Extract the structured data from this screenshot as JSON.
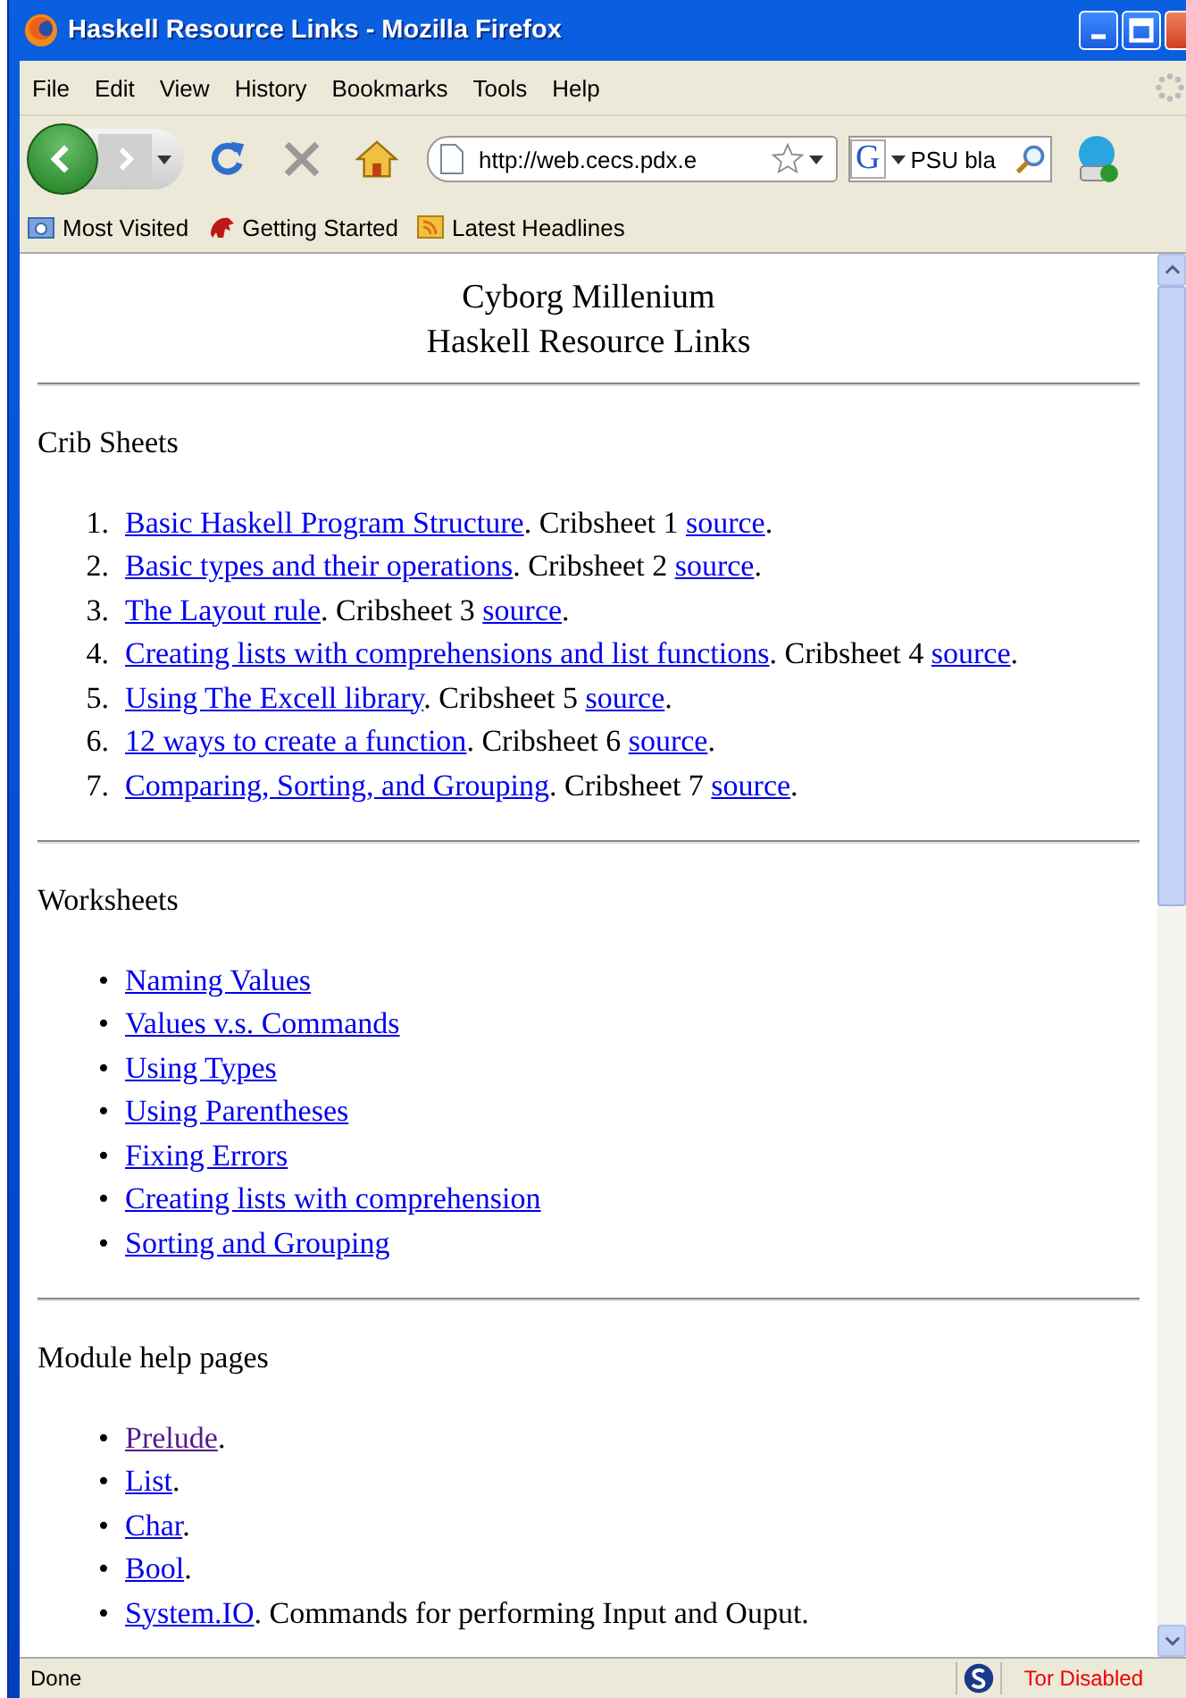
{
  "window": {
    "title": "Haskell Resource Links - Mozilla Firefox"
  },
  "menu": [
    "File",
    "Edit",
    "View",
    "History",
    "Bookmarks",
    "Tools",
    "Help"
  ],
  "toolbar": {
    "url": "http://web.cecs.pdx.e",
    "search_engine": "G",
    "search": "PSU bla"
  },
  "bookmarks": [
    {
      "label": "Most Visited",
      "kind": "folder"
    },
    {
      "label": "Getting Started",
      "kind": "start"
    },
    {
      "label": "Latest Headlines",
      "kind": "feed"
    }
  ],
  "page": {
    "title_lines": [
      "Cyborg Millenium",
      "Haskell Resource Links"
    ],
    "sections": [
      {
        "heading": "Crib Sheets",
        "markers": [
          "1.",
          "2.",
          "3.",
          "4.",
          "5.",
          "6.",
          "7."
        ],
        "items": [
          [
            {
              "kind": "link",
              "text": "Basic Haskell Program Structure",
              "visited": false
            },
            {
              "kind": "text",
              "text": ". Cribsheet 1 "
            },
            {
              "kind": "link",
              "text": "source",
              "visited": false
            },
            {
              "kind": "text",
              "text": "."
            }
          ],
          [
            {
              "kind": "link",
              "text": "Basic types and their operations",
              "visited": false
            },
            {
              "kind": "text",
              "text": ". Cribsheet 2 "
            },
            {
              "kind": "link",
              "text": "source",
              "visited": false
            },
            {
              "kind": "text",
              "text": "."
            }
          ],
          [
            {
              "kind": "link",
              "text": "The Layout rule",
              "visited": false
            },
            {
              "kind": "text",
              "text": ". Cribsheet 3 "
            },
            {
              "kind": "link",
              "text": "source",
              "visited": false
            },
            {
              "kind": "text",
              "text": "."
            }
          ],
          [
            {
              "kind": "link",
              "text": "Creating lists with comprehensions and list functions",
              "visited": false
            },
            {
              "kind": "text",
              "text": ". Cribsheet 4 "
            },
            {
              "kind": "link",
              "text": "source",
              "visited": false
            },
            {
              "kind": "text",
              "text": "."
            }
          ],
          [
            {
              "kind": "link",
              "text": "Using The Excell library",
              "visited": false
            },
            {
              "kind": "text",
              "text": ". Cribsheet 5 "
            },
            {
              "kind": "link",
              "text": "source",
              "visited": false
            },
            {
              "kind": "text",
              "text": "."
            }
          ],
          [
            {
              "kind": "link",
              "text": "12 ways to create a function",
              "visited": false
            },
            {
              "kind": "text",
              "text": ". Cribsheet 6 "
            },
            {
              "kind": "link",
              "text": "source",
              "visited": false
            },
            {
              "kind": "text",
              "text": "."
            }
          ],
          [
            {
              "kind": "link",
              "text": "Comparing, Sorting, and Grouping",
              "visited": false
            },
            {
              "kind": "text",
              "text": ". Cribsheet 7 "
            },
            {
              "kind": "link",
              "text": "source",
              "visited": false
            },
            {
              "kind": "text",
              "text": "."
            }
          ]
        ]
      },
      {
        "heading": "Worksheets",
        "markers": [
          "•",
          "•",
          "•",
          "•",
          "•",
          "•",
          "•"
        ],
        "items": [
          [
            {
              "kind": "link",
              "text": "Naming Values",
              "visited": false
            }
          ],
          [
            {
              "kind": "link",
              "text": "Values v.s. Commands",
              "visited": false
            }
          ],
          [
            {
              "kind": "link",
              "text": "Using Types",
              "visited": false
            }
          ],
          [
            {
              "kind": "link",
              "text": "Using Parentheses",
              "visited": false
            }
          ],
          [
            {
              "kind": "link",
              "text": "Fixing Errors",
              "visited": false
            }
          ],
          [
            {
              "kind": "link",
              "text": "Creating lists with comprehension",
              "visited": false
            }
          ],
          [
            {
              "kind": "link",
              "text": "Sorting and Grouping",
              "visited": false
            }
          ]
        ]
      },
      {
        "heading": "Module help pages",
        "markers": [
          "•",
          "•",
          "•",
          "•",
          "•"
        ],
        "items": [
          [
            {
              "kind": "link",
              "text": "Prelude",
              "visited": true
            },
            {
              "kind": "text",
              "text": "."
            }
          ],
          [
            {
              "kind": "link",
              "text": "List",
              "visited": false
            },
            {
              "kind": "text",
              "text": "."
            }
          ],
          [
            {
              "kind": "link",
              "text": "Char",
              "visited": false
            },
            {
              "kind": "text",
              "text": "."
            }
          ],
          [
            {
              "kind": "link",
              "text": "Bool",
              "visited": false
            },
            {
              "kind": "text",
              "text": "."
            }
          ],
          [
            {
              "kind": "link",
              "text": "System.IO",
              "visited": false
            },
            {
              "kind": "text",
              "text": ". Commands for performing Input and Ouput."
            }
          ]
        ]
      }
    ]
  },
  "status_bar": {
    "text": "Done",
    "tor": "Tor Disabled"
  }
}
